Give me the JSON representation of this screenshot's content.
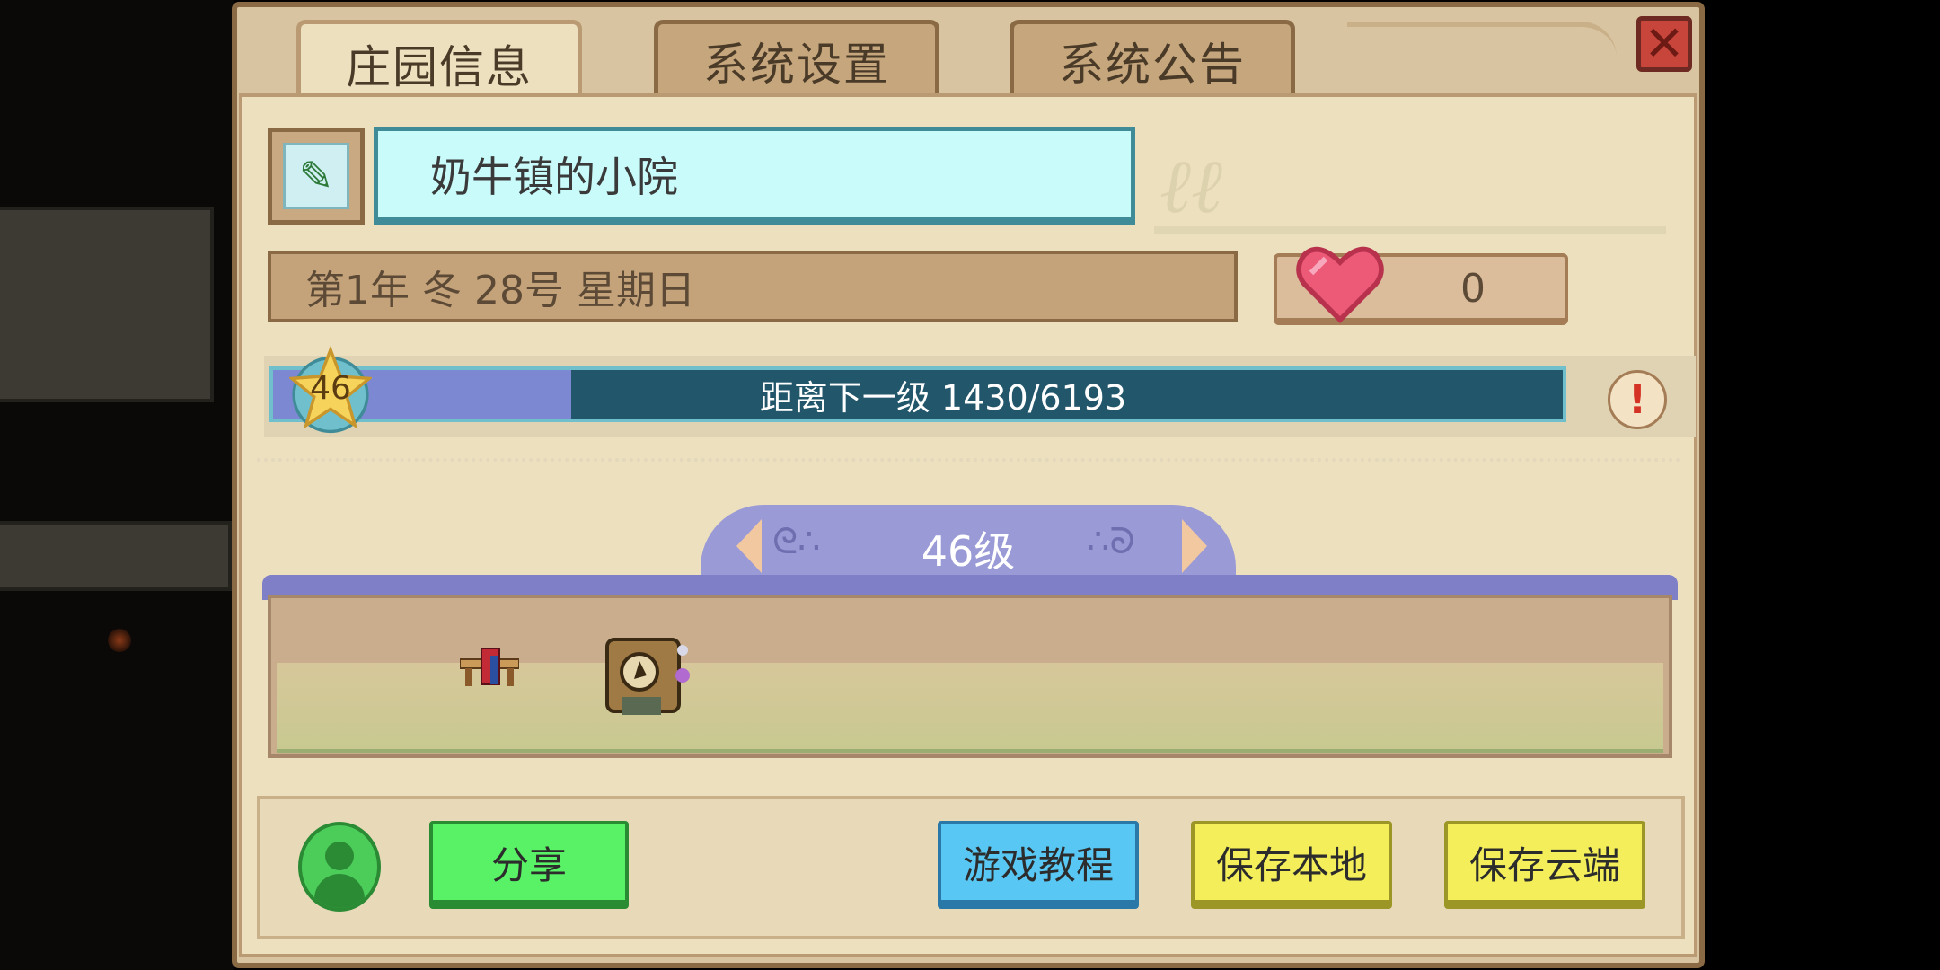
{
  "tabs": [
    {
      "label": "庄园信息",
      "active": true
    },
    {
      "label": "系统设置",
      "active": false
    },
    {
      "label": "系统公告",
      "active": false
    }
  ],
  "close_icon": "close-x-icon",
  "farm": {
    "name": "奶牛镇的小院",
    "date": "第1年  冬  28号 星期日",
    "hearts": "0"
  },
  "xp": {
    "level": "46",
    "text": "距离下一级   1430/6193",
    "current": 1430,
    "required": 6193
  },
  "level_page": {
    "label": "46级"
  },
  "buttons": {
    "share": "分享",
    "tutorial": "游戏教程",
    "save_local": "保存本地",
    "save_cloud": "保存云端"
  },
  "colors": {
    "panel": "#ede0bf",
    "xp_bar": "#22566a",
    "xp_fill": "#7c88d2",
    "share": "#59f166",
    "tutorial": "#58c7f3",
    "save": "#f3ee5a"
  }
}
